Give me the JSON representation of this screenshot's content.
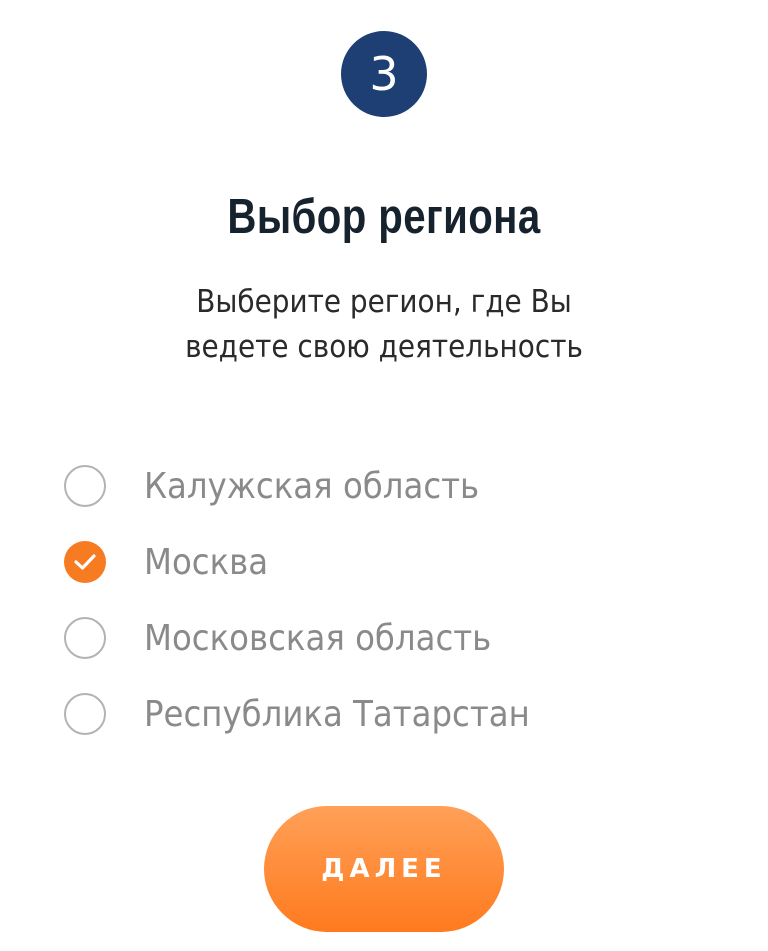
{
  "step": {
    "number": "3"
  },
  "header": {
    "title": "Выбор региона",
    "subtitle_line1": "Выберите регион, где Вы",
    "subtitle_line2": "ведете свою деятельность"
  },
  "regions": [
    {
      "label": "Калужская область",
      "selected": false
    },
    {
      "label": "Москва",
      "selected": true
    },
    {
      "label": "Московская область",
      "selected": false
    },
    {
      "label": "Республика Татарстан",
      "selected": false
    }
  ],
  "actions": {
    "next_label": "ДАЛЕЕ"
  },
  "colors": {
    "badge": "#1d3f73",
    "accent": "#f77b21",
    "title": "#16222e",
    "option_text": "#8a8a8a"
  }
}
